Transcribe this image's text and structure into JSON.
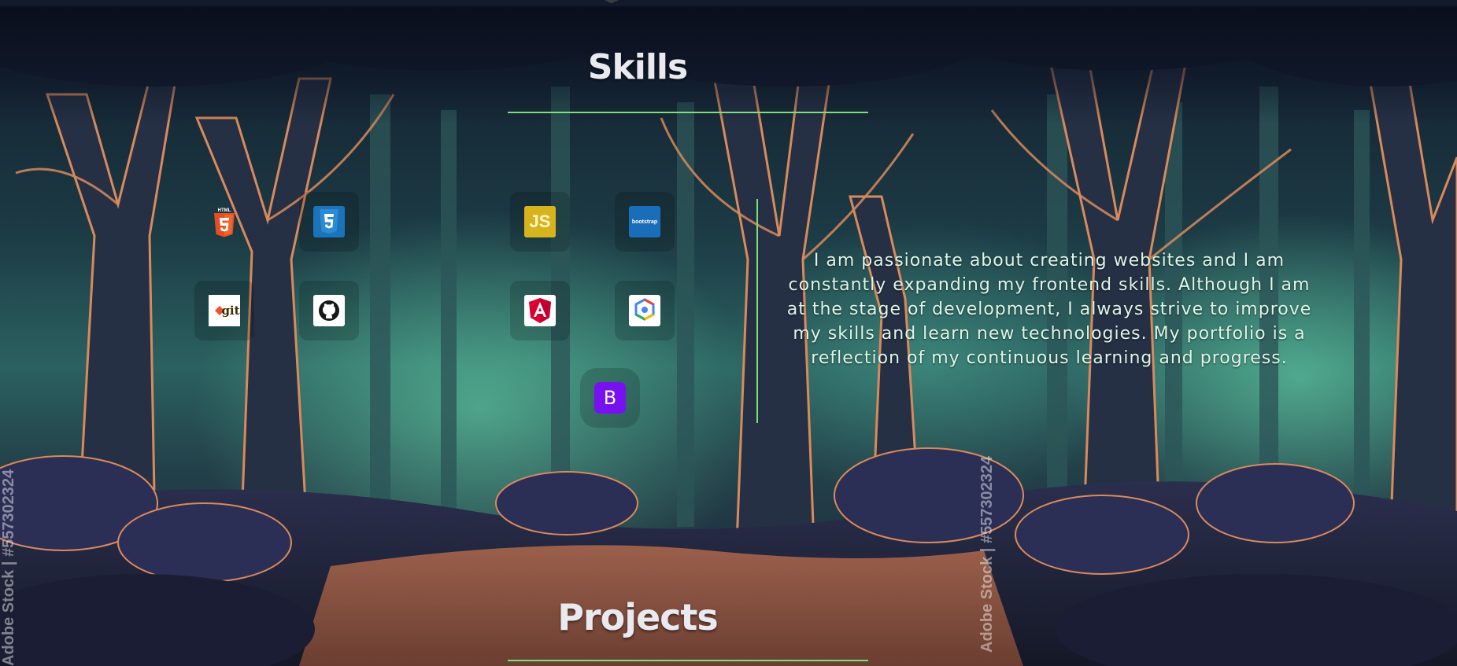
{
  "skills": {
    "title": "Skills",
    "icons": [
      {
        "name": "html5-icon",
        "label": "HTML"
      },
      {
        "name": "css3-icon",
        "label": "CSS"
      },
      {
        "name": "javascript-icon",
        "label": "JS"
      },
      {
        "name": "bootstrap5-icon",
        "label": "bootstrap"
      },
      {
        "name": "git-icon",
        "label": "git"
      },
      {
        "name": "github-icon",
        "label": ""
      },
      {
        "name": "angular-icon",
        "label": "A"
      },
      {
        "name": "google-cloud-icon",
        "label": ""
      },
      {
        "name": "bootstrap-icon",
        "label": "B"
      }
    ],
    "description": "I am passionate about creating websites and I am constantly expanding my frontend skills. Although I am at the stage of development, I always strive to improve my skills and learn new technologies. My portfolio is a reflection of my continuous learning and progress."
  },
  "projects": {
    "title": "Projects"
  },
  "watermark": {
    "left": "Adobe Stock | #557302324",
    "right": "Adobe Stock | #557302324"
  },
  "colors": {
    "accent_line": "#7ee07a",
    "title_text": "#e9e9ef",
    "body_text": "#dff5e8"
  }
}
